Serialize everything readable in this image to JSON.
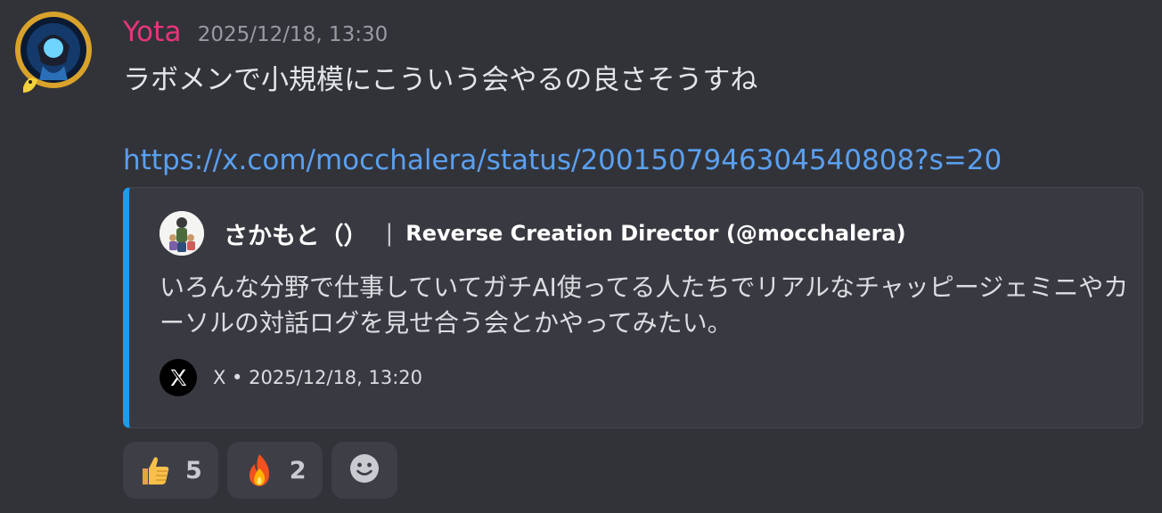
{
  "message": {
    "author": {
      "username": "Yota",
      "timestamp": "2025/12/18, 13:30",
      "name_color": "#e8357a"
    },
    "text": "ラボメンで小規模にこういう会やるの良さそうすね",
    "link": "https://x.com/mocchalera/status/2001507946304540808?s=20"
  },
  "embed": {
    "accent_color": "#1d9bf0",
    "author_name": "さかもと（）",
    "separator": "|",
    "author_handle": "Reverse Creation Director (@mocchalera)",
    "description": "いろんな分野で仕事していてガチAI使ってる人たちでリアルなチャッピージェミニやカーソルの対話ログを見せ合う会とかやってみたい。",
    "footer": "X • 2025/12/18, 13:20",
    "footer_icon": "x-logo-icon"
  },
  "reactions": [
    {
      "icon": "thumbs-up-icon",
      "count": "5"
    },
    {
      "icon": "fire-icon",
      "count": "2"
    }
  ],
  "add_reaction_icon": "add-reaction-smiley-icon"
}
